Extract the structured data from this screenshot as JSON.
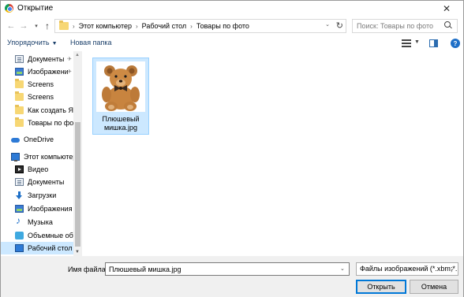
{
  "window": {
    "title": "Открытие",
    "close_glyph": "✕"
  },
  "nav": {
    "back_glyph": "←",
    "forward_glyph": "→",
    "recent_glyph": "▾",
    "up_glyph": "↑",
    "breadcrumbs": [
      "Этот компьютер",
      "Рабочий стол",
      "Товары по фото"
    ],
    "crumb_separator": "›",
    "refresh_glyph": "↻",
    "dropdown_glyph": "⌄",
    "search_placeholder": "Поиск: Товары по фото"
  },
  "toolbar": {
    "organize_label": "Упорядочить",
    "organize_caret": "▼",
    "new_folder_label": "Новая папка",
    "view_caret": "▼",
    "help_glyph": "?"
  },
  "sidebar": {
    "items": [
      {
        "label": "Документы",
        "icon": "documents-icon",
        "pinned": true
      },
      {
        "label": "Изображени",
        "icon": "pictures-icon",
        "pinned": true
      },
      {
        "label": "Screens",
        "icon": "folder-icon"
      },
      {
        "label": "Screens",
        "icon": "folder-icon"
      },
      {
        "label": "Как создать Янд",
        "icon": "folder-icon"
      },
      {
        "label": "Товары по фото",
        "icon": "folder-icon"
      },
      {
        "label": "OneDrive",
        "icon": "onedrive-icon"
      },
      {
        "label": "Этот компьютер",
        "icon": "computer-icon"
      },
      {
        "label": "Видео",
        "icon": "video-icon"
      },
      {
        "label": "Документы",
        "icon": "documents-icon"
      },
      {
        "label": "Загрузки",
        "icon": "downloads-icon"
      },
      {
        "label": "Изображения",
        "icon": "pictures-icon"
      },
      {
        "label": "Музыка",
        "icon": "music-icon"
      },
      {
        "label": "Объемные объ",
        "icon": "3d-objects-icon"
      },
      {
        "label": "Рабочий стол",
        "icon": "desktop-icon",
        "selected": true
      }
    ],
    "pin_glyph": "✈",
    "scroll_up_glyph": "▲",
    "scroll_down_glyph": "▼"
  },
  "files": [
    {
      "name": "Плюшевый мишка.jpg",
      "selected": true,
      "thumbnail": "teddy-bear-thumbnail"
    }
  ],
  "bottom": {
    "filename_label": "Имя файла:",
    "filename_value": "Плюшевый мишка.jpg",
    "filename_caret": "⌄",
    "filter_value": "Файлы изображений (*.xbm;*.",
    "filter_caret": "⌄",
    "open_label": "Открыть",
    "cancel_label": "Отмена"
  }
}
